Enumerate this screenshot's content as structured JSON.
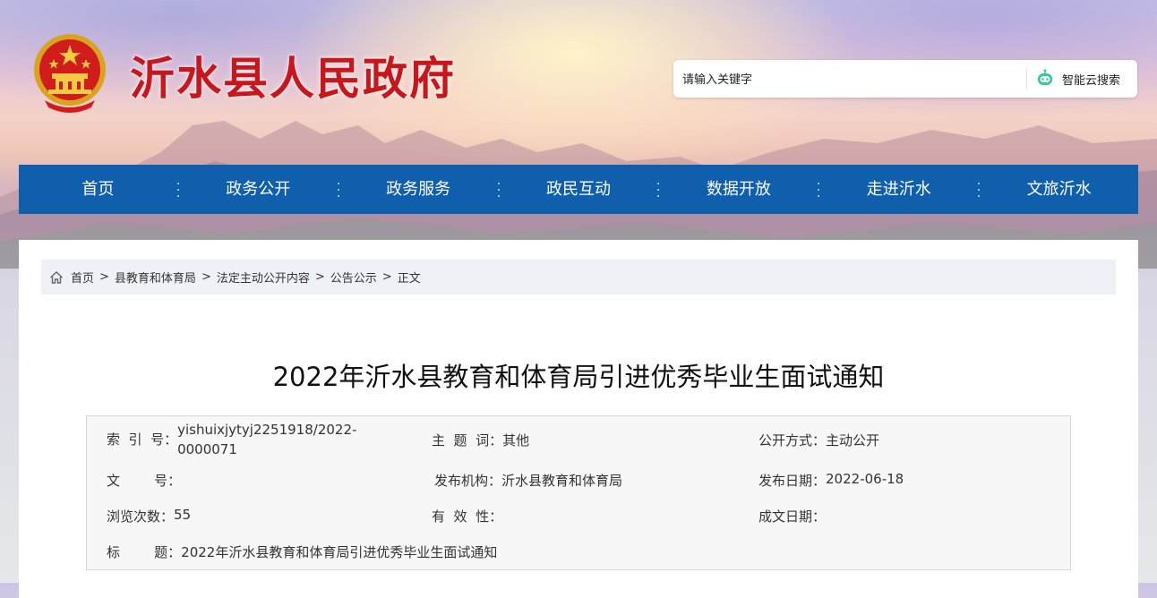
{
  "site": {
    "title": "沂水县人民政府"
  },
  "search": {
    "placeholder": "请输入关键字",
    "button_label": "智能云搜索"
  },
  "nav": {
    "items": [
      "首页",
      "政务公开",
      "政务服务",
      "政民互动",
      "数据开放",
      "走进沂水",
      "文旅沂水"
    ]
  },
  "breadcrumb": {
    "items": [
      "首页",
      "县教育和体育局",
      "法定主动公开内容",
      "公告公示",
      "正文"
    ],
    "separator": ">"
  },
  "article": {
    "title": "2022年沂水县教育和体育局引进优秀毕业生面试通知"
  },
  "meta": {
    "index_label": "索  引  号：",
    "index_value_line1": "yishuixjytyj2251918/2022-",
    "index_value_line2": "0000071",
    "subject_label": "主  题  词：",
    "subject_value": "其他",
    "disclosure_label": "公开方式：",
    "disclosure_value": "主动公开",
    "docno_label": "文        号：",
    "docno_value": "",
    "publisher_label": "发布机构：",
    "publisher_value": "沂水县教育和体育局",
    "pubdate_label": "发布日期：",
    "pubdate_value": "2022-06-18",
    "views_label": "浏览次数：",
    "views_value": "55",
    "validity_label": "有  效  性：",
    "validity_value": "",
    "created_label": "成文日期：",
    "created_value": "",
    "title_label": "标        题：",
    "title_value": "2022年沂水县教育和体育局引进优秀毕业生面试通知"
  },
  "colors": {
    "nav_bg": "#0f5fad",
    "title_red": "#c8161d",
    "breadcrumb_bg": "#eef1f6"
  }
}
